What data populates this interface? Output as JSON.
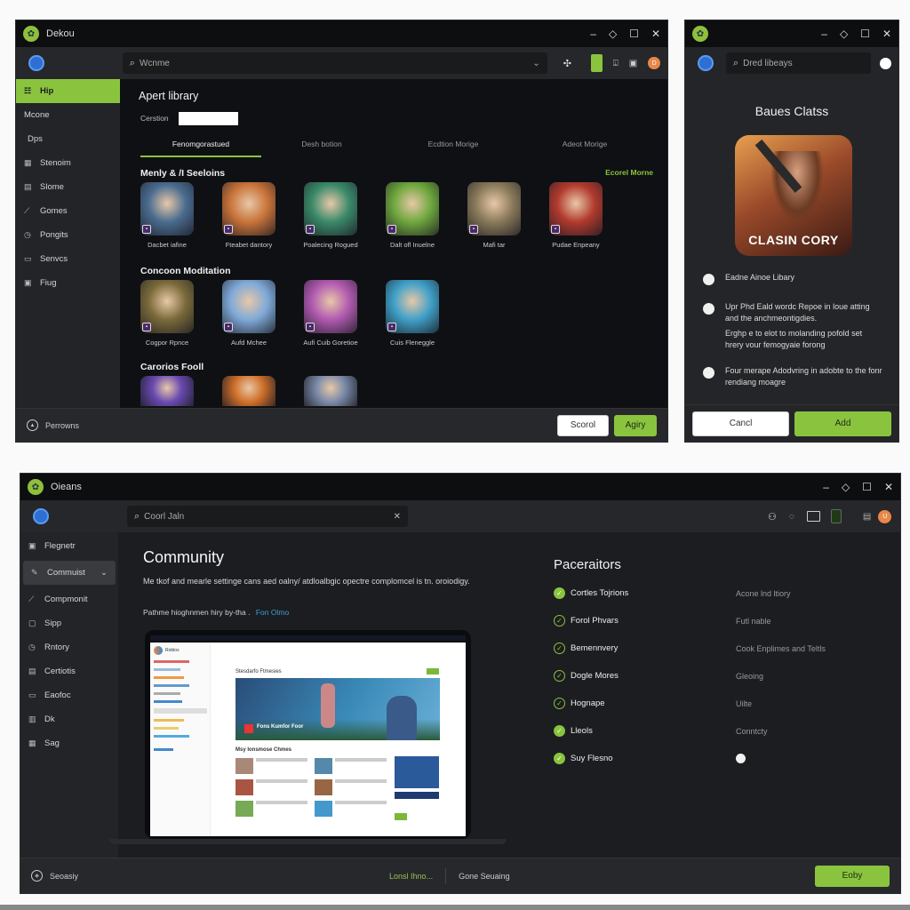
{
  "window1": {
    "title": "Dekou",
    "window_controls": [
      "–",
      "◇",
      "☐",
      "✕"
    ],
    "search_placeholder": "Wcnme",
    "toolbar_icons": [
      "move-icon",
      "green-badge-icon",
      "bell-icon",
      "calendar-icon",
      "avatar-icon"
    ],
    "avatar_initial": "D",
    "sidebar": {
      "items": [
        {
          "label": "Hip",
          "icon": "☷",
          "active": true
        },
        {
          "label": "Mcone",
          "icon": "",
          "active": false
        },
        {
          "label": "Dps",
          "icon": "",
          "active": false
        },
        {
          "label": "Stenoim",
          "icon": "▦",
          "active": false
        },
        {
          "label": "Slome",
          "icon": "▤",
          "active": false
        },
        {
          "label": "Gomes",
          "icon": "⟋",
          "active": false
        },
        {
          "label": "Pongits",
          "icon": "◷",
          "active": false
        },
        {
          "label": "Senvcs",
          "icon": "▭",
          "active": false
        },
        {
          "label": "Fiug",
          "icon": "▣",
          "active": false
        }
      ]
    },
    "main": {
      "title": "Apert library",
      "filter_label": "Cerstion",
      "filter_value": "",
      "tabs": [
        {
          "label": "Fenomgorastued",
          "active": true
        },
        {
          "label": "Desh botion",
          "active": false
        },
        {
          "label": "Ecdtion Morige",
          "active": false
        },
        {
          "label": "Adeot Morige",
          "active": false
        }
      ],
      "see_more": "Ecorel Morne",
      "sections": [
        {
          "title": "Menly & /I Seeloins",
          "items": [
            {
              "caption": "Dacbet iafine",
              "color": "#4a6c8f"
            },
            {
              "caption": "Fteabet dantory",
              "color": "#c9743a"
            },
            {
              "caption": "Poalecing Rogued",
              "color": "#3a8a6a"
            },
            {
              "caption": "Dalt ofl Inuelne",
              "color": "#6fa83e"
            },
            {
              "caption": "Mafi tar",
              "color": "#8a7a5a"
            },
            {
              "caption": "Pudae Enpeany",
              "color": "#b23a2e"
            }
          ]
        },
        {
          "title": "Concoon Moditation",
          "items": [
            {
              "caption": "Cogpor Rpnce",
              "color": "#7a6a3a"
            },
            {
              "caption": "Aufd Mchee",
              "color": "#7fa9d8"
            },
            {
              "caption": "Aufi Cuib Goretioe",
              "color": "#b05ab0"
            },
            {
              "caption": "Cuis Fleneggle",
              "color": "#3fa0c8"
            }
          ]
        },
        {
          "title": "Carorios Fooll",
          "items": [
            {
              "caption": "",
              "color": "#6a4ab0"
            },
            {
              "caption": "",
              "color": "#d0702a"
            },
            {
              "caption": "",
              "color": "#7a8aa8"
            }
          ]
        }
      ]
    },
    "footer": {
      "left_label": "Perrowns",
      "cancel": "Scorol",
      "apply": "Agiry"
    }
  },
  "window2": {
    "title": "",
    "window_controls": [
      "–",
      "◇",
      "☐",
      "✕"
    ],
    "search_placeholder": "Dred libeays",
    "heading": "Baues Clatss",
    "game_art_title": "CLASIN CORY",
    "options": [
      {
        "text": "Eadne Ainoe Libary",
        "selected": false
      },
      {
        "text": "Upr Phd Eald wordc Repoe in loue atting and the anchmeontigdies.",
        "selected": false
      },
      {
        "text": "Erghp e to elot to molanding pofold set hrery vour femogyaie forong",
        "selected": false,
        "no_radio": true
      },
      {
        "text": "Four merape Adodvring in adobte to the fonr rendiang moagre",
        "selected": false
      }
    ],
    "cancel": "Cancl",
    "add": "Add"
  },
  "window3": {
    "title": "Oieans",
    "window_controls": [
      "–",
      "◇",
      "☐",
      "✕"
    ],
    "search_placeholder": "Coorl Jaln",
    "toolbar_icons": [
      "group-icon",
      "chat-icon",
      "monitor-icon",
      "battery-icon",
      "card-icon",
      "avatar-icon"
    ],
    "avatar_initial": "U",
    "sidebar": {
      "items": [
        {
          "label": "Flegnetr",
          "icon": "▣",
          "active": false
        },
        {
          "label": "Commuist",
          "icon": "✎",
          "active": true,
          "expandable": true
        },
        {
          "label": "Compmonit",
          "icon": "⟋",
          "active": false
        },
        {
          "label": "Sipp",
          "icon": "▢",
          "active": false
        },
        {
          "label": "Rntory",
          "icon": "◷",
          "active": false
        },
        {
          "label": "Certiotis",
          "icon": "▤",
          "active": false
        },
        {
          "label": "Eaofoc",
          "icon": "▭",
          "active": false
        },
        {
          "label": "Dk",
          "icon": "▥",
          "active": false
        },
        {
          "label": "Sag",
          "icon": "▦",
          "active": false
        }
      ]
    },
    "main": {
      "title": "Community",
      "description": "Me tkof and mearle settinge cans aed oalny/ atdloalbgic opectre complomcel is tn. oroiodigy.",
      "sub_text": "Pathme hioghnmen hiry by-tha .",
      "link": "Fon Olmo",
      "preview": {
        "brand": "Roblox",
        "banner_title": "Fons Kumfor Foor",
        "section_title": "Msy Ionsmose Chmes",
        "page_heading": "Stesdarfo Ftmesies"
      }
    },
    "parameters": {
      "title": "Paceraitors",
      "rows": [
        {
          "name": "Cortles Tojrions",
          "value": "Acone lnd ltiory",
          "check": "filled"
        },
        {
          "name": "Forol Phvars",
          "value": "Futl nable",
          "check": "outline"
        },
        {
          "name": "Bemennvery",
          "value": "Cook Enplimes and Teltls",
          "check": "outline"
        },
        {
          "name": "Dogle Mores",
          "value": "Gleoing",
          "check": "outline"
        },
        {
          "name": "Hognape",
          "value": "Uilte",
          "check": "outline"
        },
        {
          "name": "Lleols",
          "value": "Conntcty",
          "check": "filled"
        },
        {
          "name": "Suy Flesno",
          "value": "",
          "check": "filled",
          "value_radio": true
        }
      ]
    },
    "footer": {
      "left_label": "Seoasiy",
      "center_link": "Lonsl Ihno...",
      "center_text": "Gone Seuaing",
      "apply": "Eoby"
    }
  },
  "colors": {
    "accent": "#8ac43f",
    "window_bg": "#1c1d20",
    "titlebar": "#0d0e10",
    "link": "#3a9fd8",
    "avatar": "#e8874a"
  }
}
